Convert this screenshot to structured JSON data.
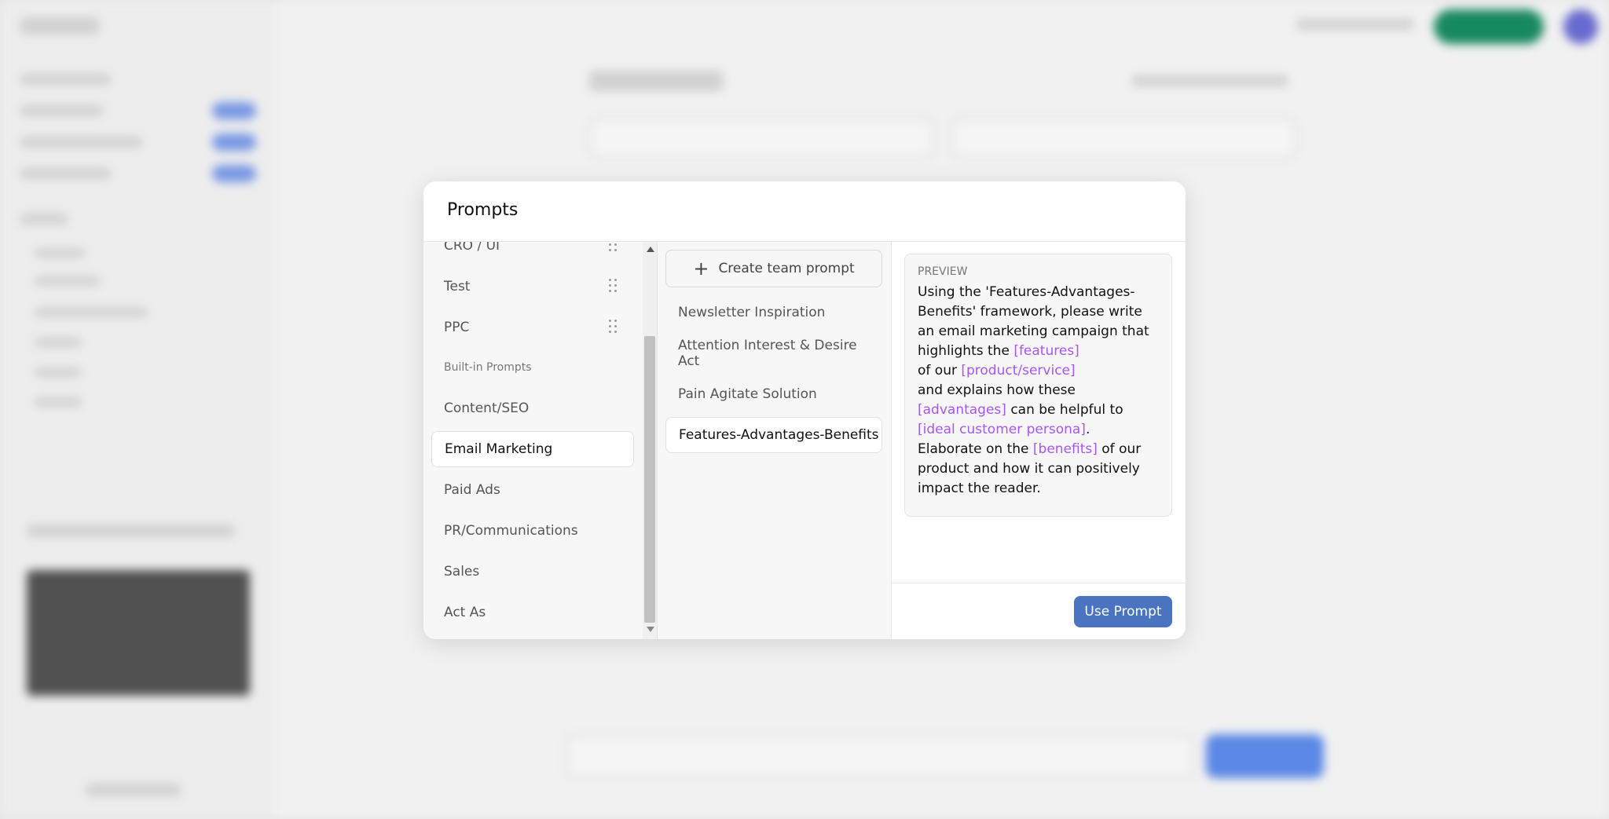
{
  "modal": {
    "title": "Prompts"
  },
  "categories": {
    "team_items": [
      {
        "label": "CRO / UI"
      },
      {
        "label": "Test"
      },
      {
        "label": "PPC"
      }
    ],
    "builtin_heading": "Built-in Prompts",
    "builtin_items": [
      {
        "label": "Content/SEO"
      },
      {
        "label": "Email Marketing",
        "active": true
      },
      {
        "label": "Paid Ads"
      },
      {
        "label": "PR/Communications"
      },
      {
        "label": "Sales"
      },
      {
        "label": "Act As"
      }
    ]
  },
  "prompts": {
    "create_label": "Create team prompt",
    "items": [
      {
        "label": "Newsletter Inspiration"
      },
      {
        "label": "Attention Interest & Desire Act"
      },
      {
        "label": "Pain Agitate Solution"
      },
      {
        "label": "Features-Advantages-Benefits",
        "active": true
      }
    ]
  },
  "preview": {
    "label": "PREVIEW",
    "text_1": "Using the 'Features-Advantages-Benefits' framework, please write an email marketing campaign that highlights the ",
    "var_features": "[features]",
    "text_2": "of our ",
    "var_product": "[product/service]",
    "text_3": "and explains how these ",
    "var_advantages": "[advantages]",
    "text_4": " can be helpful to ",
    "var_persona": "[ideal customer persona]",
    "text_5": ".",
    "text_6": "Elaborate on the ",
    "var_benefits": "[benefits]",
    "text_7": " of our product and how it can positively impact the reader.",
    "use_label": "Use Prompt"
  },
  "colors": {
    "accent": "#4a74c2",
    "variable": "#a855f7"
  }
}
